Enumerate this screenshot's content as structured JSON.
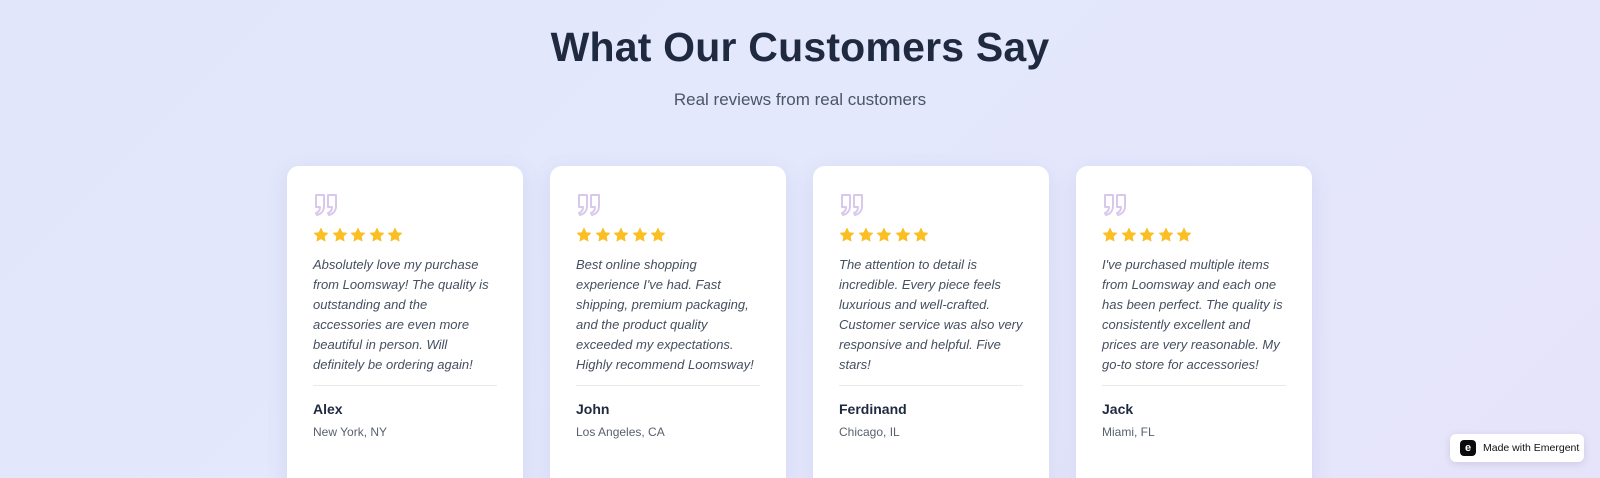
{
  "header": {
    "title": "What Our Customers Say",
    "subtitle": "Real reviews from real customers"
  },
  "colors": {
    "star": "#FBBF24",
    "quote_icon": "#D9C8EC",
    "heading": "#1F2940"
  },
  "testimonials": [
    {
      "rating": 5,
      "text": "Absolutely love my purchase from Loomsway! The quality is outstanding and the accessories are even more beautiful in person. Will definitely be ordering again!",
      "name": "Alex",
      "location": "New York, NY"
    },
    {
      "rating": 5,
      "text": "Best online shopping experience I've had. Fast shipping, premium packaging, and the product quality exceeded my expectations. Highly recommend Loomsway!",
      "name": "John",
      "location": "Los Angeles, CA"
    },
    {
      "rating": 5,
      "text": "The attention to detail is incredible. Every piece feels luxurious and well-crafted. Customer service was also very responsive and helpful. Five stars!",
      "name": "Ferdinand",
      "location": "Chicago, IL"
    },
    {
      "rating": 5,
      "text": "I've purchased multiple items from Loomsway and each one has been perfect. The quality is consistently excellent and prices are very reasonable. My go-to store for accessories!",
      "name": "Jack",
      "location": "Miami, FL"
    }
  ],
  "badge": {
    "icon": "emergent-logo-icon",
    "logo_glyph": "e",
    "label": "Made with Emergent"
  }
}
